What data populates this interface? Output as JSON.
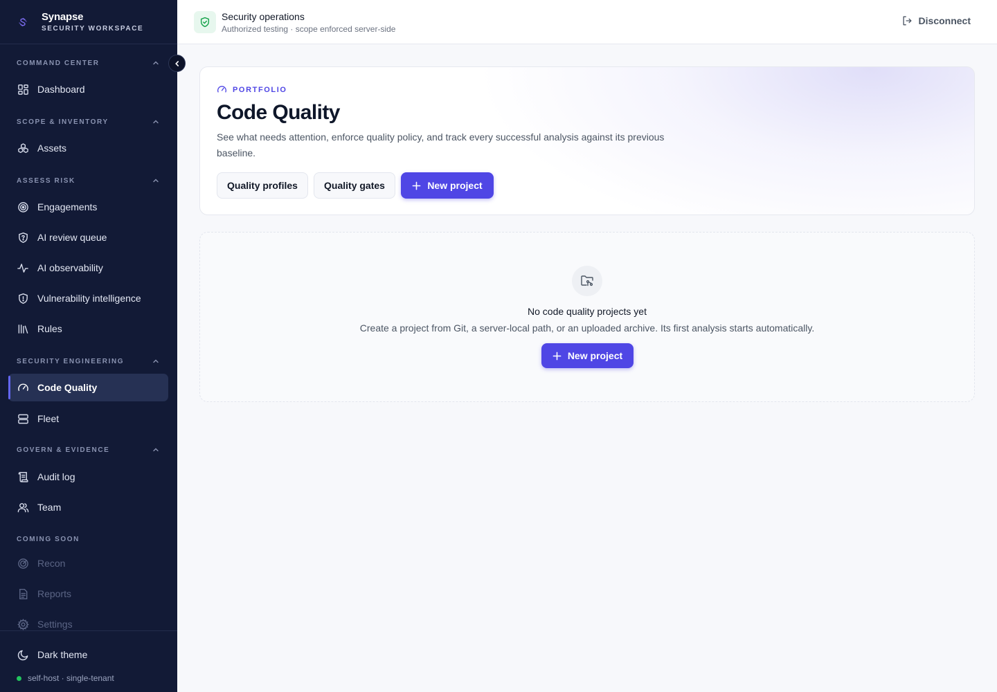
{
  "brand": {
    "name": "Synapse",
    "subtitle": "SECURITY WORKSPACE"
  },
  "sidebar": {
    "sections": [
      {
        "title": "COMMAND CENTER",
        "items": [
          {
            "label": "Dashboard",
            "icon": "dashboard-icon"
          }
        ]
      },
      {
        "title": "SCOPE & INVENTORY",
        "items": [
          {
            "label": "Assets",
            "icon": "assets-icon"
          }
        ]
      },
      {
        "title": "ASSESS RISK",
        "items": [
          {
            "label": "Engagements",
            "icon": "target-icon"
          },
          {
            "label": "AI review queue",
            "icon": "shield-question-icon"
          },
          {
            "label": "AI observability",
            "icon": "activity-icon"
          },
          {
            "label": "Vulnerability intelligence",
            "icon": "shield-alert-icon"
          },
          {
            "label": "Rules",
            "icon": "library-icon"
          }
        ]
      },
      {
        "title": "SECURITY ENGINEERING",
        "items": [
          {
            "label": "Code Quality",
            "icon": "gauge-icon",
            "active": true
          },
          {
            "label": "Fleet",
            "icon": "server-icon"
          }
        ]
      },
      {
        "title": "GOVERN & EVIDENCE",
        "items": [
          {
            "label": "Audit log",
            "icon": "scroll-icon"
          },
          {
            "label": "Team",
            "icon": "users-icon"
          }
        ]
      },
      {
        "title": "COMING SOON",
        "items": [
          {
            "label": "Recon",
            "icon": "radar-icon",
            "disabled": true
          },
          {
            "label": "Reports",
            "icon": "file-text-icon",
            "disabled": true
          },
          {
            "label": "Settings",
            "icon": "gear-icon",
            "disabled": true
          }
        ]
      }
    ],
    "footer": {
      "theme_label": "Dark theme",
      "host_status": "self-host · single-tenant",
      "status_color": "#22c55e"
    }
  },
  "topbar": {
    "title": "Security operations",
    "subtitle": "Authorized testing · scope enforced server-side",
    "disconnect_label": "Disconnect"
  },
  "hero": {
    "eyebrow": "PORTFOLIO",
    "title": "Code Quality",
    "description": "See what needs attention, enforce quality policy, and track every successful analysis against its previous baseline.",
    "buttons": {
      "quality_profiles": "Quality profiles",
      "quality_gates": "Quality gates",
      "new_project": "New project"
    }
  },
  "empty_state": {
    "title": "No code quality projects yet",
    "description": "Create a project from Git, a server-local path, or an uploaded archive. Its first analysis starts automatically.",
    "button": "New project"
  },
  "colors": {
    "sidebar_bg": "#121a36",
    "accent": "#4f46e5",
    "active_item_bg": "#263154"
  }
}
